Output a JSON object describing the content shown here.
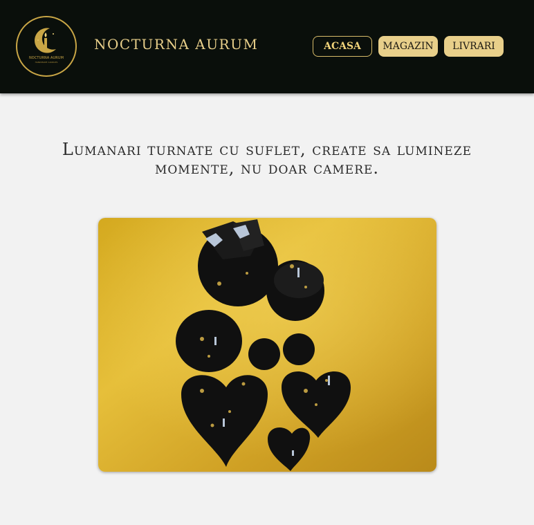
{
  "header": {
    "logo": {
      "icon": "moon-candle-icon",
      "text": "NOCTURNA AURUM",
      "subtext": "HANDMADE CANDLES"
    },
    "brand_name": "NOCTURNA AURUM",
    "nav": [
      {
        "label": "ACASA",
        "active": true
      },
      {
        "label": "MAGAZIN",
        "active": false
      },
      {
        "label": "LIVRARI",
        "active": false
      }
    ]
  },
  "main": {
    "tagline": "Lumanari turnate cu suflet, create sa lumineze momente, nu doar camere.",
    "photo": {
      "subject": "black-and-gold-candles-photo"
    }
  },
  "colors": {
    "header_bg": "#0a0f0b",
    "gold": "#e8cf8a",
    "page_bg": "#f2f2f2"
  }
}
